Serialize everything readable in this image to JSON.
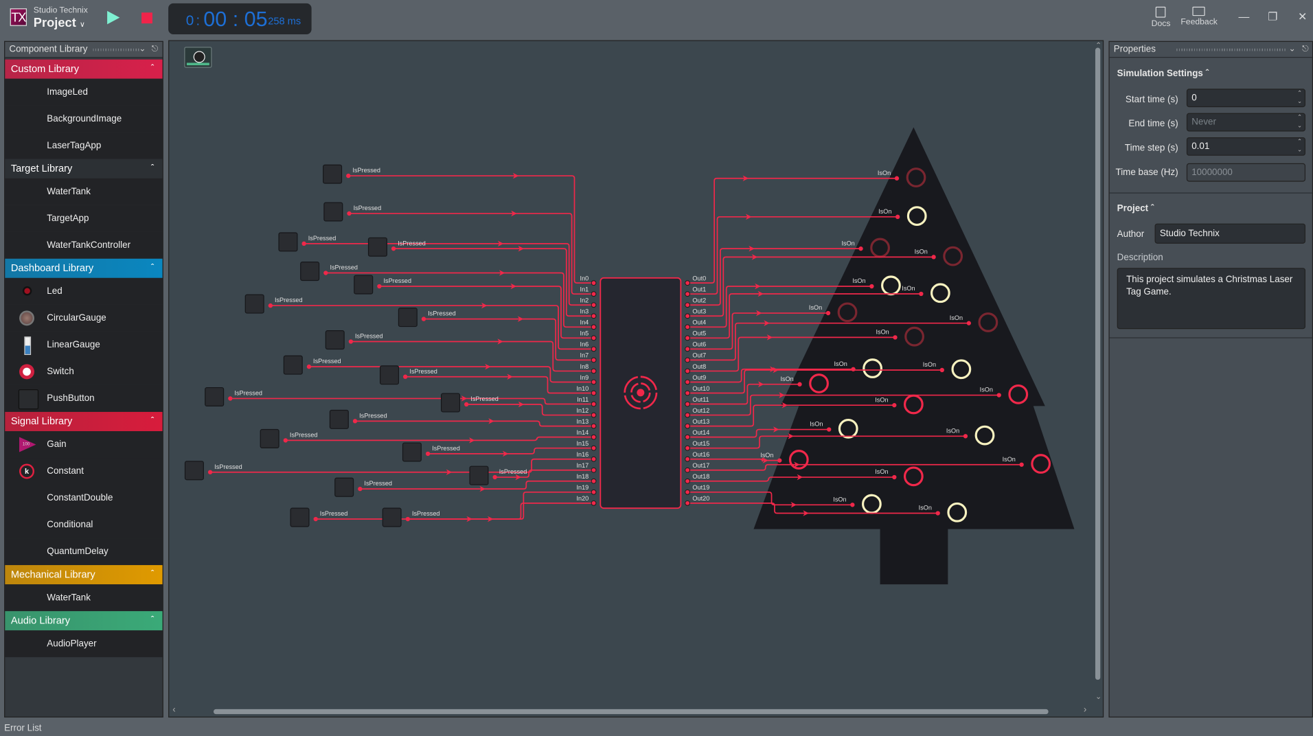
{
  "titlebar": {
    "logo_text": "TX",
    "brand": "Studio Technix",
    "project": "Project",
    "timer": {
      "hours": "0",
      "time": "00 : 05",
      "ms": "258 ms",
      "color": "#1d6fd6"
    },
    "docs_label": "Docs",
    "feedback_label": "Feedback",
    "icons": {
      "play": "play-icon",
      "stop": "stop-icon",
      "minimize": "—",
      "restore": "❐",
      "close": "✕"
    }
  },
  "library": {
    "title": "Component Library",
    "sections": [
      {
        "label": "Custom Library",
        "color": "#d8204a",
        "items": [
          {
            "label": "ImageLed"
          },
          {
            "label": "BackgroundImage"
          },
          {
            "label": "LaserTagApp"
          }
        ]
      },
      {
        "label": "Target Library",
        "color": "#2c3034",
        "items": [
          {
            "label": "WaterTank"
          },
          {
            "label": "TargetApp"
          },
          {
            "label": "WaterTankController"
          }
        ]
      },
      {
        "label": "Dashboard Library",
        "color": "#0a87c0",
        "items": [
          {
            "label": "Led",
            "icon": "led"
          },
          {
            "label": "CircularGauge",
            "icon": "circular-gauge"
          },
          {
            "label": "LinearGauge",
            "icon": "linear-gauge"
          },
          {
            "label": "Switch",
            "icon": "switch"
          },
          {
            "label": "PushButton",
            "icon": "push-button"
          }
        ]
      },
      {
        "label": "Signal Library",
        "color": "#d81c3c",
        "items": [
          {
            "label": "Gain",
            "icon": "gain",
            "icon_text": "100"
          },
          {
            "label": "Constant",
            "icon": "constant",
            "icon_text": "k"
          },
          {
            "label": "ConstantDouble"
          },
          {
            "label": "Conditional"
          },
          {
            "label": "QuantumDelay"
          }
        ]
      },
      {
        "label": "Mechanical Library",
        "color": "#e09a00",
        "items": [
          {
            "label": "WaterTank"
          }
        ]
      },
      {
        "label": "Audio Library",
        "color": "#3aaa78",
        "items": [
          {
            "label": "AudioPlayer"
          }
        ]
      }
    ]
  },
  "canvas": {
    "button_label": "IsPressed",
    "led_label": "IsOn",
    "block_inputs": [
      "In0",
      "In1",
      "In2",
      "In3",
      "In4",
      "In5",
      "In6",
      "In7",
      "In8",
      "In9",
      "In10",
      "In11",
      "In12",
      "In13",
      "In14",
      "In15",
      "In16",
      "In17",
      "In18",
      "In19",
      "In20"
    ],
    "block_outputs": [
      "Out0",
      "Out1",
      "Out2",
      "Out3",
      "Out4",
      "Out5",
      "Out6",
      "Out7",
      "Out8",
      "Out9",
      "Out10",
      "Out11",
      "Out12",
      "Out13",
      "Out14",
      "Out15",
      "Out16",
      "Out17",
      "Out18",
      "Out19",
      "Out20"
    ],
    "led_states": [
      "off",
      "on",
      "off",
      "off",
      "on",
      "on",
      "off",
      "off",
      "off",
      "on",
      "on",
      "red",
      "red",
      "red",
      "on",
      "on",
      "red",
      "red",
      "red",
      "on",
      "on"
    ],
    "colors": {
      "wire": "#f0284a",
      "led_off": "#7a2630",
      "led_on": "#f8f2c0",
      "led_red": "#f0284a",
      "tree": "#18191e",
      "canvas": "#3c474e"
    }
  },
  "properties": {
    "title": "Properties",
    "simulation": {
      "heading": "Simulation Settings",
      "start_label": "Start time (s)",
      "start_value": "0",
      "end_label": "End time (s)",
      "end_placeholder": "Never",
      "step_label": "Time step (s)",
      "step_value": "0.01",
      "base_label": "Time base (Hz)",
      "base_value": "10000000"
    },
    "project": {
      "heading": "Project",
      "author_label": "Author",
      "author_value": "Studio Technix",
      "description_label": "Description",
      "description_value": "This project simulates a Christmas Laser Tag Game."
    }
  },
  "footer": {
    "error_list": "Error List"
  }
}
